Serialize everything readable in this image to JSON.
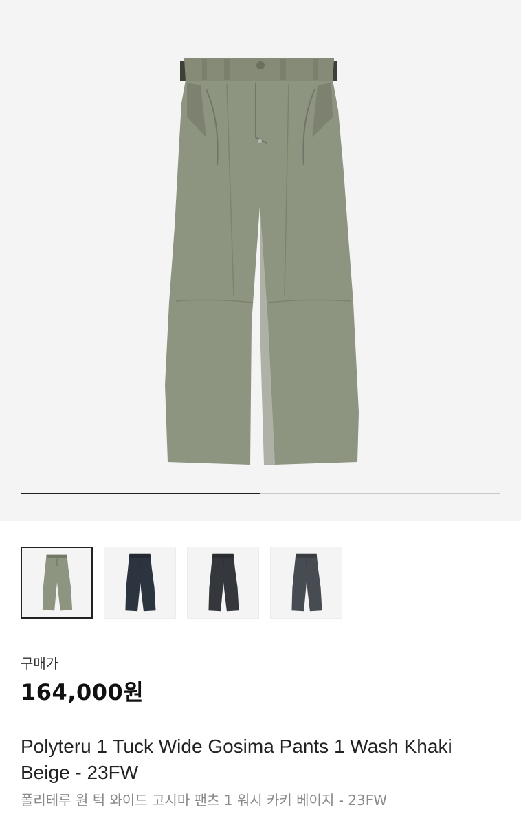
{
  "product": {
    "main_image_icon": "khaki-pants-image",
    "colors": {
      "khaki": "#8d9480",
      "navy": "#2c3440",
      "charcoal": "#34373b",
      "slate": "#474b52"
    }
  },
  "gallery": {
    "progress": 0.5
  },
  "thumbnails": [
    {
      "icon": "khaki-pants-thumbnail",
      "color": "#8d9480",
      "selected": true
    },
    {
      "icon": "navy-pants-thumbnail",
      "color": "#2c3440",
      "selected": false
    },
    {
      "icon": "charcoal-pants-thumbnail",
      "color": "#34373b",
      "selected": false
    },
    {
      "icon": "slate-pants-thumbnail",
      "color": "#474b52",
      "selected": false
    }
  ],
  "pricing": {
    "label": "구매가",
    "price": "164,000원"
  },
  "title": {
    "english": "Polyteru 1 Tuck Wide Gosima Pants 1 Wash Khaki Beige - 23FW",
    "korean": "폴리테루 원 턱 와이드 고시마 팬츠 1 워시 카키 베이지 - 23FW"
  }
}
